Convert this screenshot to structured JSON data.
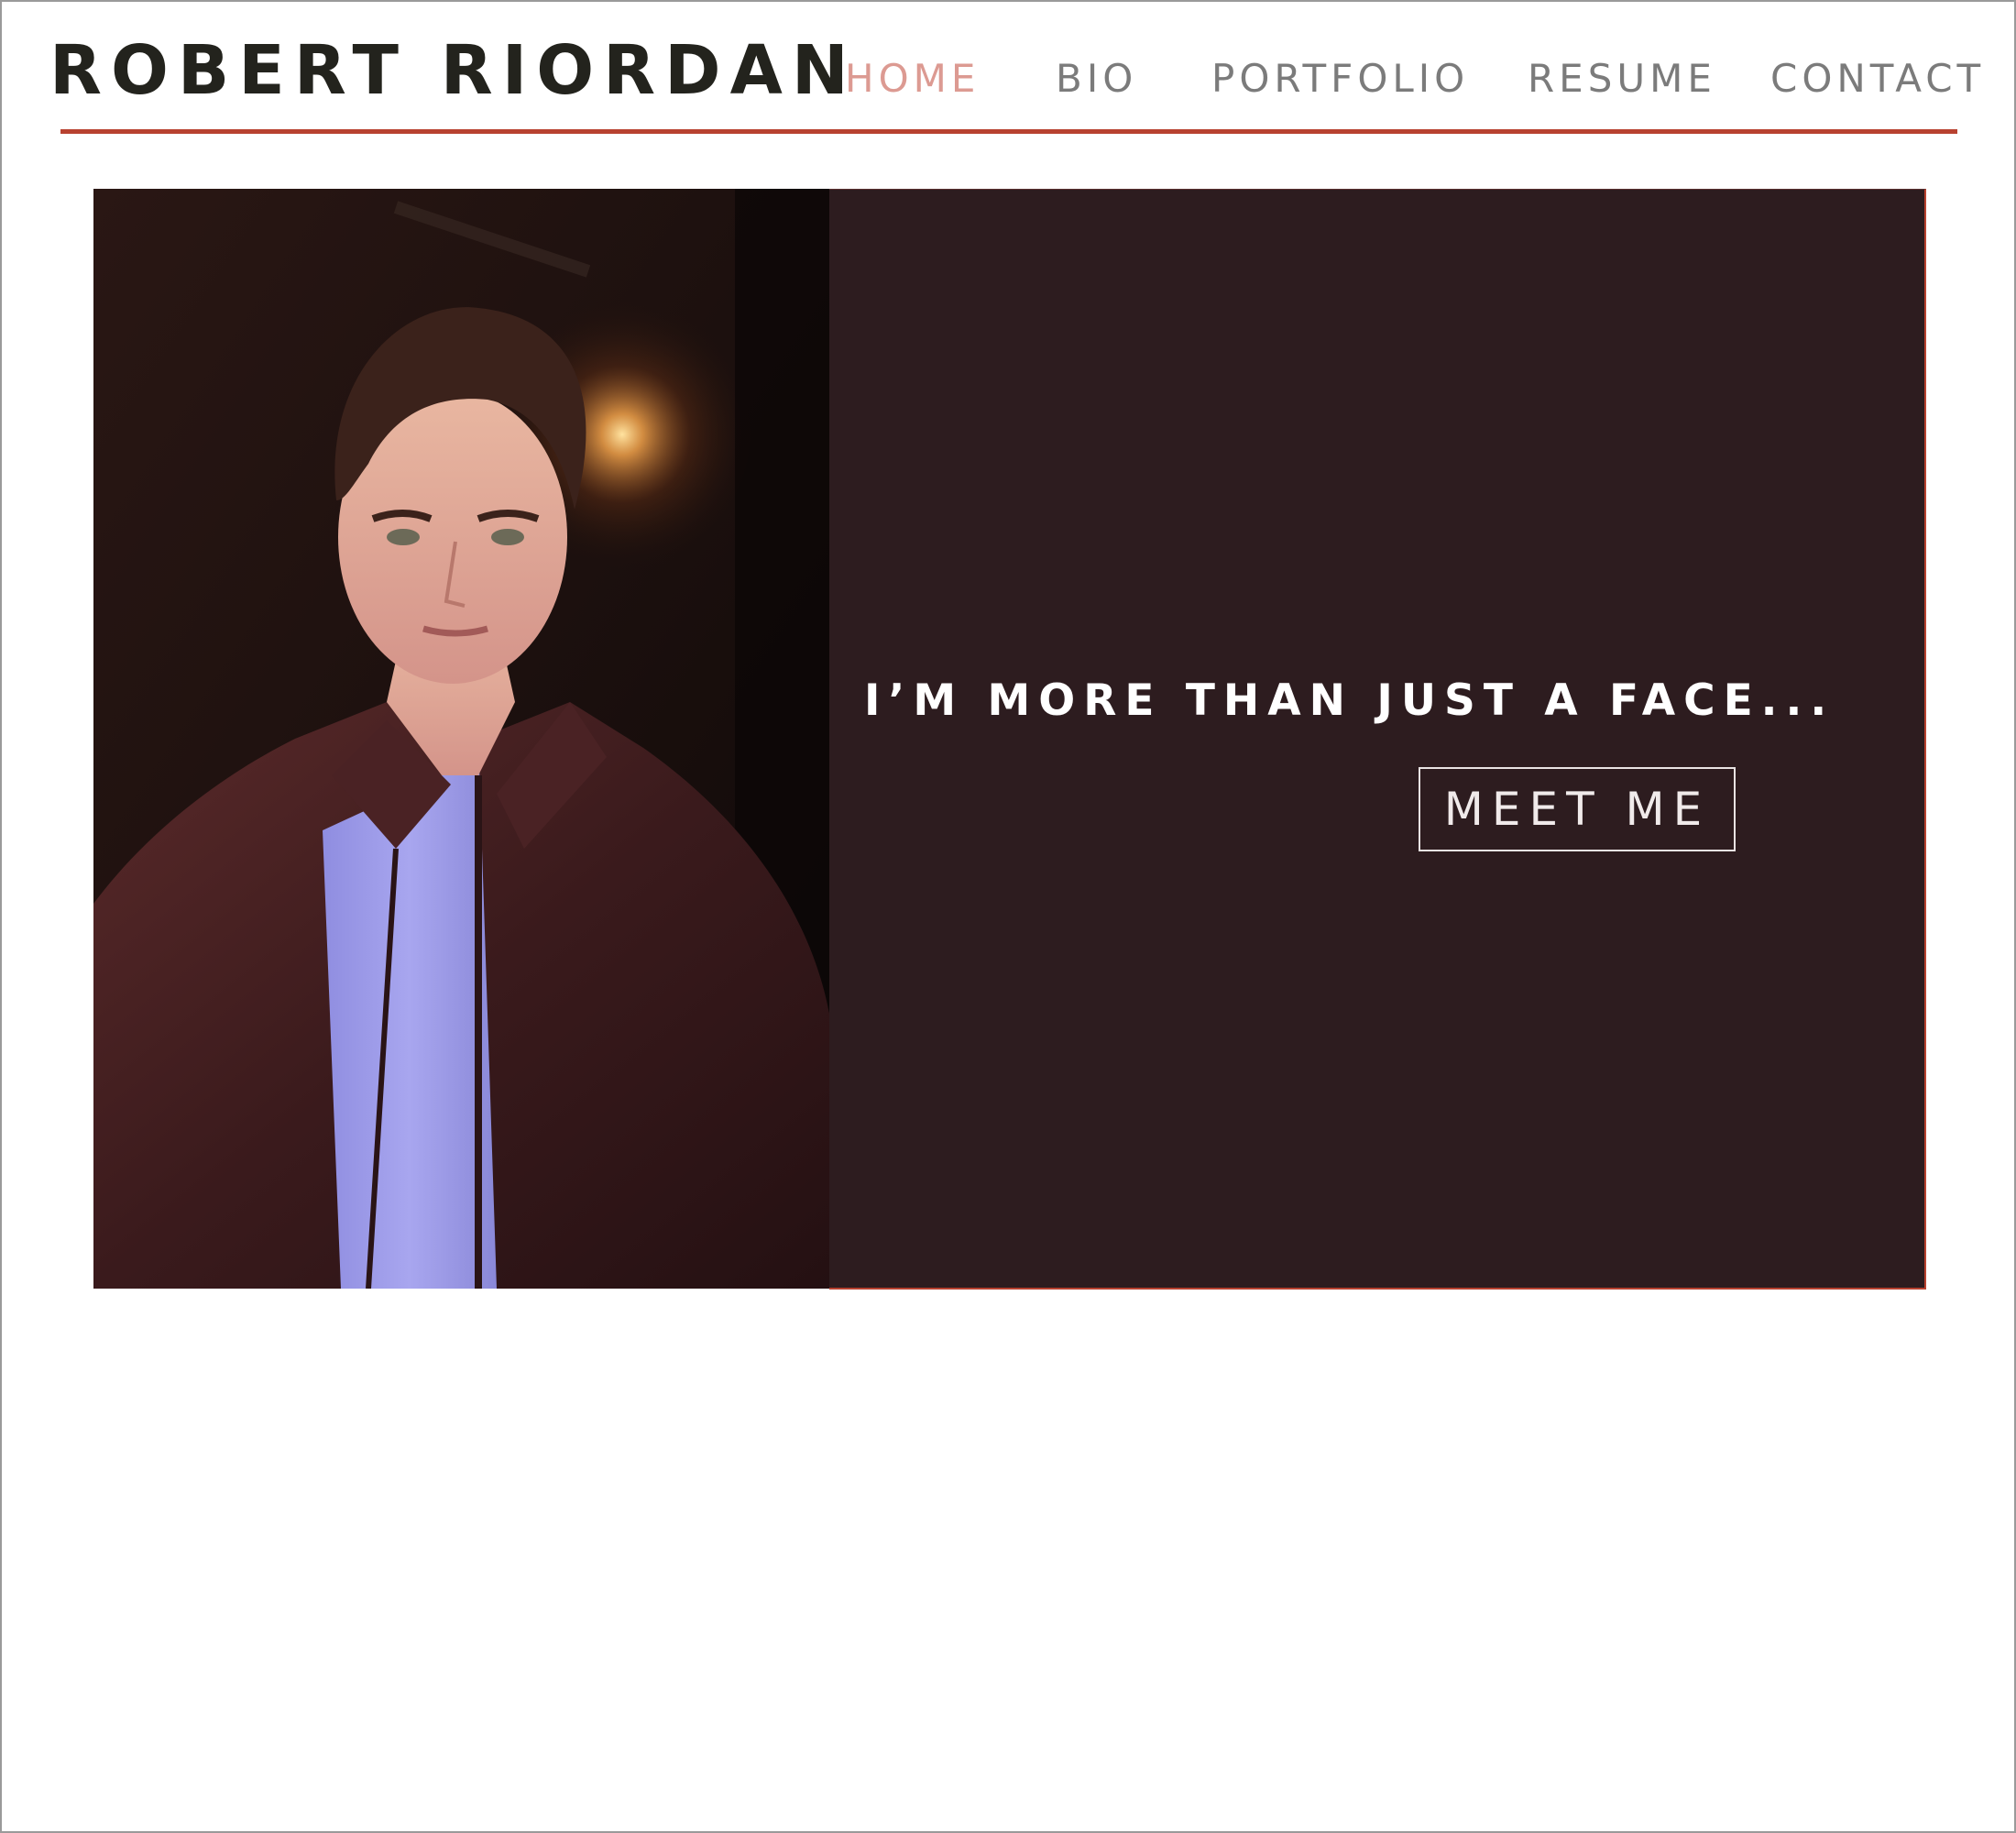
{
  "header": {
    "site_title": "ROBERT RIORDAN",
    "accent_color": "#b84230"
  },
  "nav": {
    "items": [
      {
        "label": "HOME",
        "active": true
      },
      {
        "label": "BIO",
        "active": false
      },
      {
        "label": "PORTFOLIO",
        "active": false
      },
      {
        "label": "RESUME",
        "active": false
      },
      {
        "label": "CONTACT",
        "active": false
      }
    ],
    "active_color": "#dc9a92",
    "inactive_color": "#7b7b7b"
  },
  "hero": {
    "tagline": "I’M MORE THAN JUST A FACE...",
    "cta_label": "MEET ME",
    "panel_color": "#2d1c1f"
  }
}
